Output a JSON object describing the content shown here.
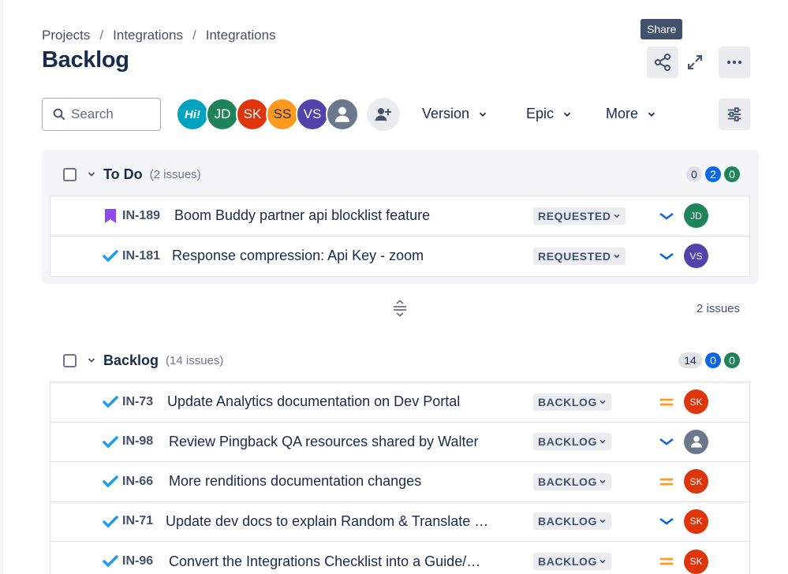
{
  "breadcrumb": [
    "Projects",
    "Integrations",
    "Integrations"
  ],
  "page_title": "Backlog",
  "tooltip": "Share",
  "search": {
    "placeholder": "Search"
  },
  "avatars": [
    {
      "initials": "Hi!",
      "color": "#00a3bf",
      "icon": "logo-avatar"
    },
    {
      "initials": "JD",
      "color": "#1f845a"
    },
    {
      "initials": "SK",
      "color": "#de350b"
    },
    {
      "initials": "SS",
      "color": "#ff991f"
    },
    {
      "initials": "VS",
      "color": "#5243aa"
    },
    {
      "initials": "",
      "color": "#6b778c",
      "icon": "person-icon"
    }
  ],
  "filters": {
    "version": "Version",
    "epic": "Epic",
    "more": "More"
  },
  "sprint": {
    "title": "To Do",
    "count_text": "(2 issues)",
    "counts": [
      "0",
      "2",
      "0"
    ],
    "issues": [
      {
        "type": "bookmark-icon",
        "key": "IN-189",
        "summary": "Boom Buddy partner api blocklist feature",
        "status": "REQUESTED",
        "priority": "low",
        "assignee": "JD",
        "assignee_color": "#1f845a"
      },
      {
        "type": "task-check-icon",
        "key": "IN-181",
        "summary": "Response compression: Api Key - zoom",
        "status": "REQUESTED",
        "priority": "low",
        "assignee": "VS",
        "assignee_color": "#5243aa"
      }
    ],
    "total": "2 issues"
  },
  "backlog": {
    "title": "Backlog",
    "count_text": "(14 issues)",
    "counts": [
      "14",
      "0",
      "0"
    ],
    "issues": [
      {
        "key": "IN-73",
        "summary": "Update Analytics documentation on Dev Portal",
        "status": "BACKLOG",
        "priority": "medium",
        "assignee": "SK",
        "assignee_color": "#de350b"
      },
      {
        "key": "IN-98",
        "summary": "Review Pingback QA resources shared by Walter",
        "status": "BACKLOG",
        "priority": "low",
        "assignee": "",
        "assignee_color": "#6b778c"
      },
      {
        "key": "IN-66",
        "summary": "More renditions documentation changes",
        "status": "BACKLOG",
        "priority": "medium",
        "assignee": "SK",
        "assignee_color": "#de350b"
      },
      {
        "key": "IN-71",
        "summary": "Update dev docs to explain Random & Translate …",
        "status": "BACKLOG",
        "priority": "low",
        "assignee": "SK",
        "assignee_color": "#de350b"
      },
      {
        "key": "IN-96",
        "summary": "Convert the Integrations Checklist into a Guide/…",
        "status": "BACKLOG",
        "priority": "medium",
        "assignee": "SK",
        "assignee_color": "#de350b"
      }
    ]
  }
}
